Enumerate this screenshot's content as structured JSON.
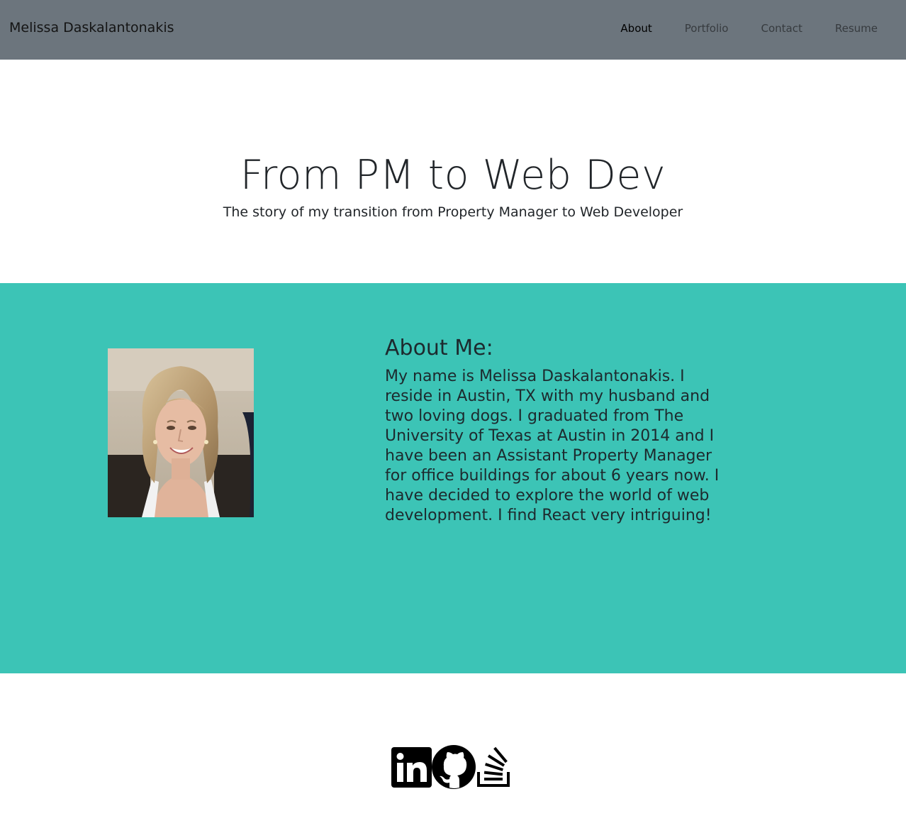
{
  "navbar": {
    "brand": "Melissa Daskalantonakis",
    "links": [
      {
        "label": "About",
        "active": true
      },
      {
        "label": "Portfolio",
        "active": false
      },
      {
        "label": "Contact",
        "active": false
      },
      {
        "label": "Resume",
        "active": false
      }
    ],
    "background_color": "#6c757d"
  },
  "hero": {
    "title": "From PM to Web Dev",
    "subtitle": "The story of my transition from Property Manager to Web Developer"
  },
  "about": {
    "heading": "About Me:",
    "body": "My name is Melissa Daskalantonakis. I reside in Austin, TX with my husband and two loving dogs. I graduated from The University of Texas at Austin in 2014 and I have been an Assistant Property Manager for office buildings for about 6 years now. I have decided to explore the world of web development. I find React very intriguing!",
    "photo_icon": "profile-photo",
    "background_color": "#3cc4b6"
  },
  "footer": {
    "social_icons": [
      "linkedin-icon",
      "github-icon",
      "stackoverflow-icon"
    ]
  }
}
